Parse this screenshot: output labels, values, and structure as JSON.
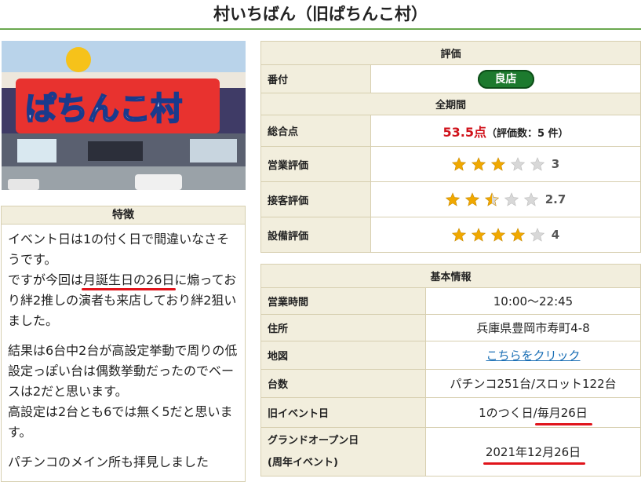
{
  "page_title": "村いちばん（旧ぱちんこ村）",
  "photo": {
    "sign_text": "ぱちんこ村"
  },
  "feature": {
    "header": "特徴",
    "para1_a": "イベント日は1の付く日で間違いなさそうです。",
    "para1_b": "ですが今回は",
    "para1_ul": "月誕生日の26日",
    "para1_c": "に煽っており絆2推しの演者も来店しており絆2狙いました。",
    "para2": "結果は6台中2台が高設定挙動で周りの低設定っぽい台は偶数挙動だったのでベースは2だと思います。",
    "para3": "高設定は2台とも6では無く5だと思います。",
    "para4": "パチンコのメイン所も拝見しました"
  },
  "evaluation": {
    "header": "評価",
    "rank_label": "番付",
    "rank_value": "良店",
    "period_header": "全期間",
    "total_label": "総合点",
    "total_score": "53.5点",
    "total_sub": "（評価数：5 件）",
    "ratings": [
      {
        "label": "営業評価",
        "stars": 3,
        "value": "3"
      },
      {
        "label": "接客評価",
        "stars": 2.5,
        "value": "2.7"
      },
      {
        "label": "設備評価",
        "stars": 4,
        "value": "4"
      }
    ]
  },
  "basic": {
    "header": "基本情報",
    "rows": [
      {
        "label": "営業時間",
        "value": "10:00〜22:45"
      },
      {
        "label": "住所",
        "value": "兵庫県豊岡市寿町4-8"
      },
      {
        "label": "地図",
        "value": "こちらをクリック"
      },
      {
        "label": "台数",
        "value": "パチンコ251台/スロット122台"
      }
    ],
    "event_label": "旧イベント日",
    "event_value_a": "1のつく日/",
    "event_value_b": "毎月26日",
    "open_label_1": "グランドオープン日",
    "open_label_2": "(周年イベント)",
    "open_value": "2021年12月26日"
  },
  "colors": {
    "accent_green": "#6aa84f",
    "badge_green": "#1d7a2e",
    "score_red": "#d0121b",
    "star_gold": "#f0a800"
  }
}
